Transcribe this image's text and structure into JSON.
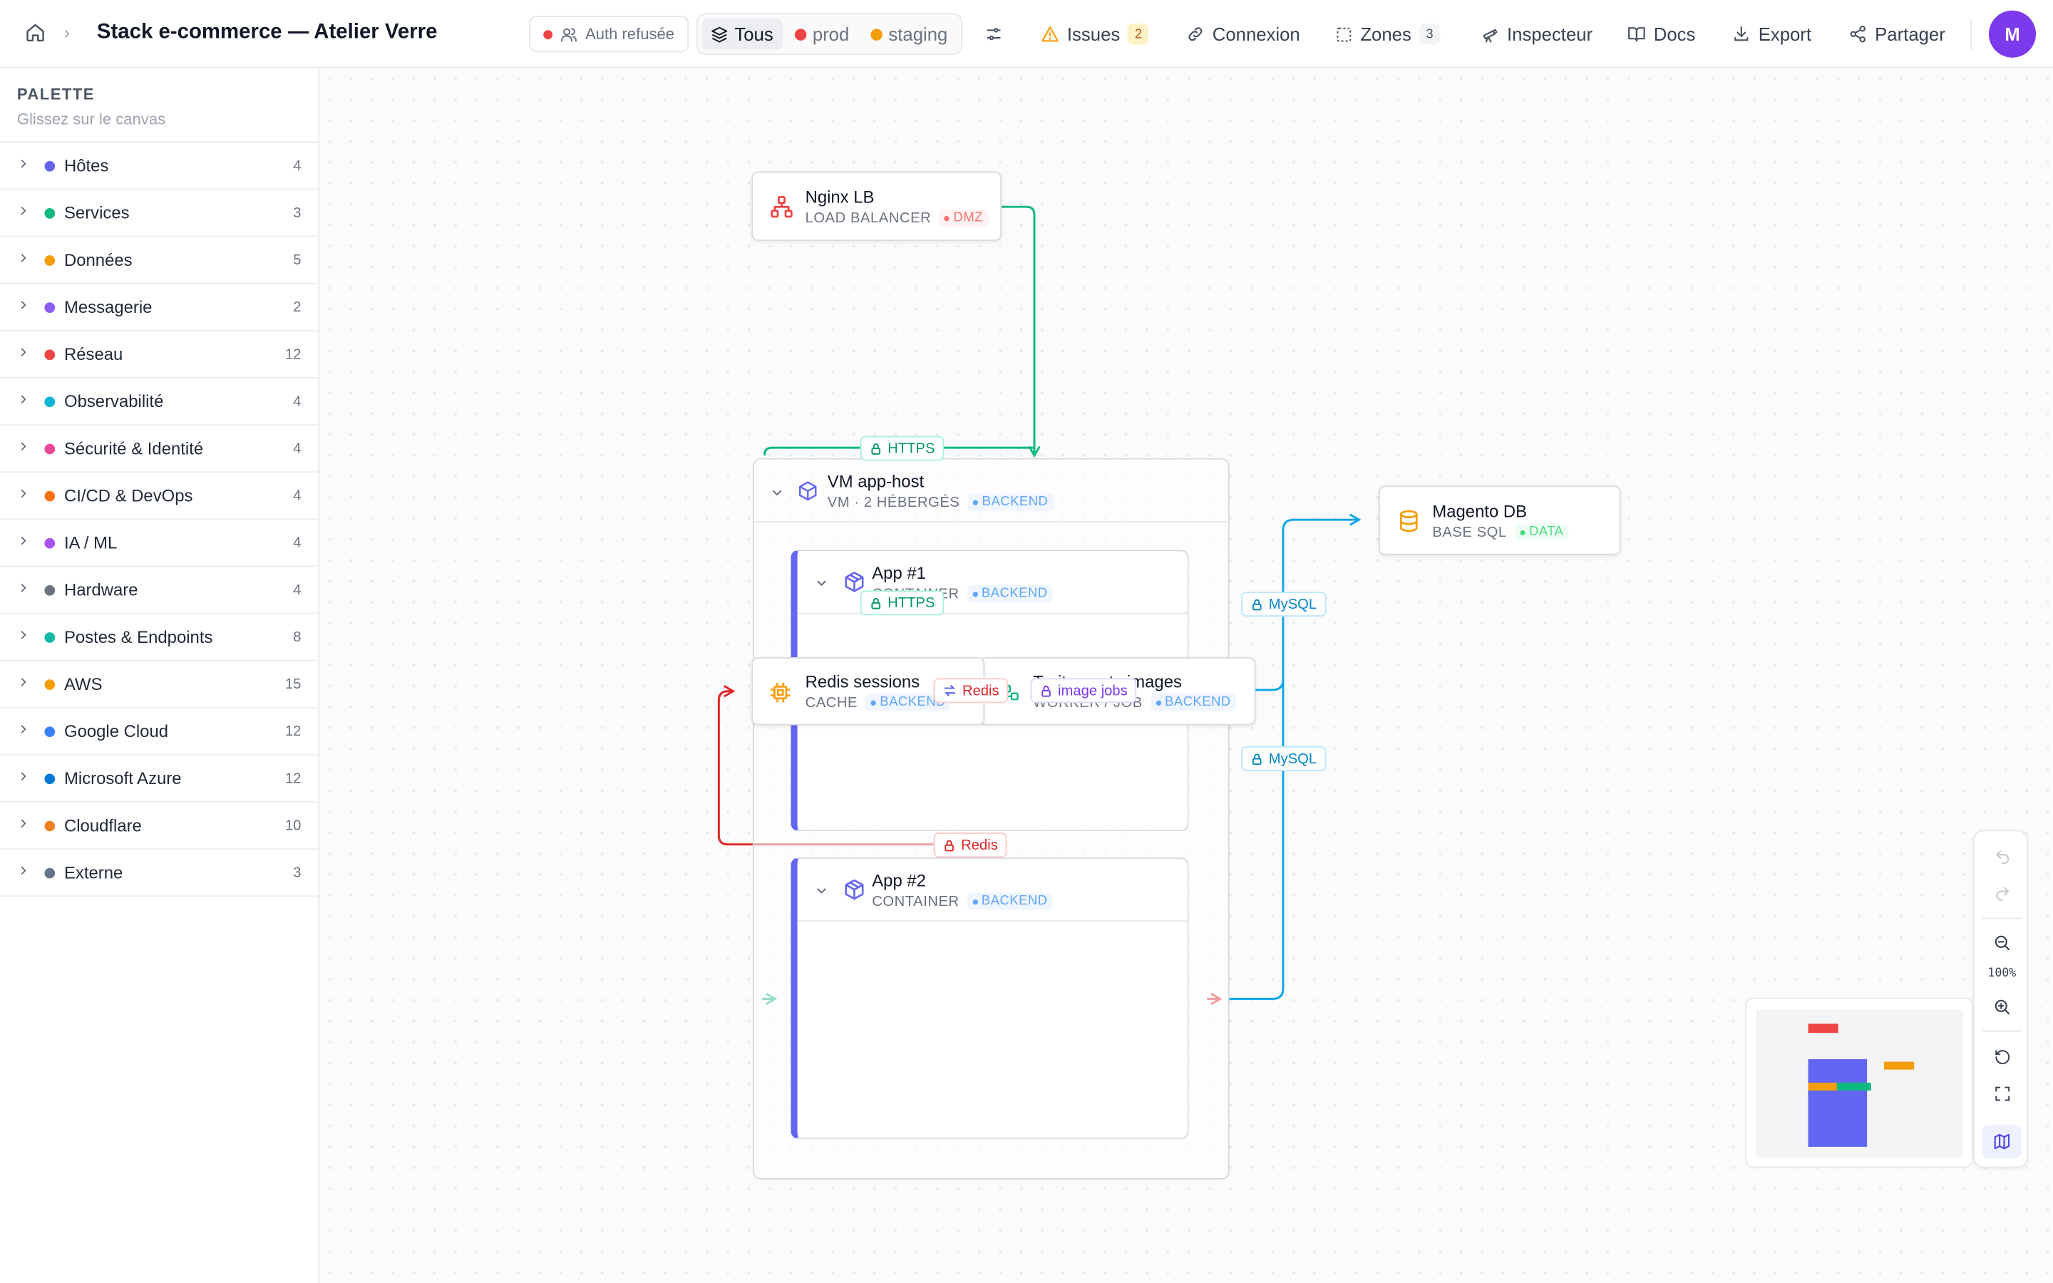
{
  "header": {
    "title": "Stack e-commerce — Atelier Verre",
    "auth_status": "Auth refusée",
    "env_filter": [
      {
        "label": "Tous",
        "color": "#374151"
      },
      {
        "label": "prod",
        "color": "#ef4444"
      },
      {
        "label": "staging",
        "color": "#f59e0b"
      }
    ],
    "issues_label": "Issues",
    "issues_count": "2",
    "connexion_label": "Connexion",
    "zones_label": "Zones",
    "zones_count": "3",
    "inspecteur_label": "Inspecteur",
    "docs_label": "Docs",
    "export_label": "Export",
    "partager_label": "Partager",
    "avatar_initial": "M"
  },
  "palette": {
    "title": "PALETTE",
    "subtitle": "Glissez sur le canvas",
    "categories": [
      {
        "label": "Hôtes",
        "count": "4",
        "color": "#6366f1"
      },
      {
        "label": "Services",
        "count": "3",
        "color": "#10b981"
      },
      {
        "label": "Données",
        "count": "5",
        "color": "#f59e0b"
      },
      {
        "label": "Messagerie",
        "count": "2",
        "color": "#8b5cf6"
      },
      {
        "label": "Réseau",
        "count": "12",
        "color": "#ef4444"
      },
      {
        "label": "Observabilité",
        "count": "4",
        "color": "#06b6d4"
      },
      {
        "label": "Sécurité & Identité",
        "count": "4",
        "color": "#ec4899"
      },
      {
        "label": "CI/CD & DevOps",
        "count": "4",
        "color": "#f97316"
      },
      {
        "label": "IA / ML",
        "count": "4",
        "color": "#a855f7"
      },
      {
        "label": "Hardware",
        "count": "4",
        "color": "#6b7280"
      },
      {
        "label": "Postes & Endpoints",
        "count": "8",
        "color": "#14b8a6"
      },
      {
        "label": "AWS",
        "count": "15",
        "color": "#f59e0b"
      },
      {
        "label": "Google Cloud",
        "count": "12",
        "color": "#3b82f6"
      },
      {
        "label": "Microsoft Azure",
        "count": "12",
        "color": "#0078d4"
      },
      {
        "label": "Cloudflare",
        "count": "10",
        "color": "#f38020"
      },
      {
        "label": "Externe",
        "count": "3",
        "color": "#64748b"
      }
    ]
  },
  "nodes": {
    "nginx": {
      "name": "Nginx LB",
      "type": "LOAD BALANCER",
      "zone": "DMZ"
    },
    "vm": {
      "name": "VM app-host",
      "type": "VM · 2 HÉBERGÉS",
      "zone": "BACKEND"
    },
    "app1": {
      "name": "App #1",
      "type": "CONTAINER",
      "zone": "BACKEND"
    },
    "app2": {
      "name": "App #2",
      "type": "CONTAINER",
      "zone": "BACKEND"
    },
    "redis": {
      "name": "Redis sessions",
      "type": "CACHE",
      "zone": "BACKEND"
    },
    "worker": {
      "name": "Traitements images",
      "type": "WORKER / JOB",
      "zone": "BACKEND"
    },
    "magento": {
      "name": "Magento DB",
      "type": "BASE SQL",
      "zone": "DATA"
    }
  },
  "edges": {
    "https_top": "HTTPS",
    "https_app1": "HTTPS",
    "mysql_1": "MySQL",
    "mysql_2": "MySQL",
    "redis_1": "Redis",
    "redis_2": "Redis",
    "image_jobs": "image jobs"
  },
  "zoom": {
    "level": "100%"
  },
  "colors": {
    "dmz": "#ef4444",
    "backend": "#60a5fa",
    "data": "#22c55e",
    "https": "#10b981",
    "mysql": "#0ea5e9",
    "redis": "#dc2626",
    "jobs": "#7c3aed",
    "container_accent": "#6366f1"
  }
}
